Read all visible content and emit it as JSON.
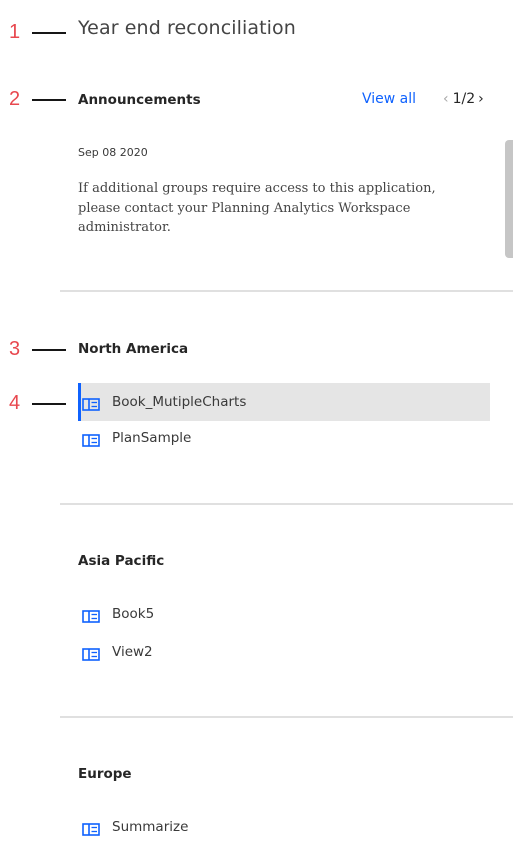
{
  "page_title": "Year end reconciliation",
  "callouts": [
    "1",
    "2",
    "3",
    "4"
  ],
  "announcements": {
    "title": "Announcements",
    "view_all": "View all",
    "pager_current": "1",
    "pager_sep": "/",
    "pager_total": "2",
    "pager_prev": "‹",
    "pager_next": "›",
    "date": "Sep 08 2020",
    "text": "If additional groups require access to this application, please contact your Planning Analytics Workspace administrator."
  },
  "groups": [
    {
      "name": "North America",
      "items": [
        {
          "label": "Book_MutipleCharts",
          "selected": true
        },
        {
          "label": "PlanSample",
          "selected": false
        }
      ]
    },
    {
      "name": "Asia Pacific",
      "items": [
        {
          "label": "Book5",
          "selected": false
        },
        {
          "label": "View2",
          "selected": false
        }
      ]
    },
    {
      "name": "Europe",
      "items": [
        {
          "label": "Summarize",
          "selected": false
        }
      ]
    }
  ],
  "colors": {
    "accent": "#0f62fe",
    "callout": "#e8484f",
    "icon": "#0f62fe"
  },
  "icons": {
    "item": "book-icon",
    "prev": "chevron-left-icon",
    "next": "chevron-right-icon"
  }
}
